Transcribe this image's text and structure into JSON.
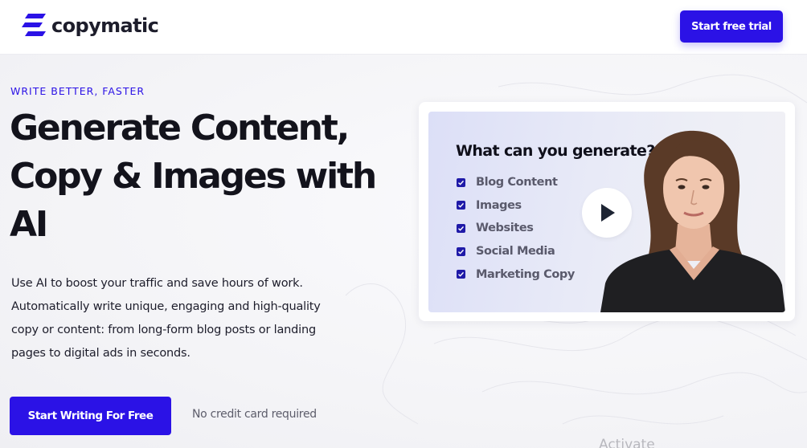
{
  "header": {
    "brand_name": "copymatic",
    "trial_button": "Start free trial"
  },
  "hero": {
    "eyebrow": "WRITE BETTER, FASTER",
    "headline_lines": [
      "Generate Content,",
      "Copy & Images with",
      "AI"
    ],
    "lead_lines": [
      "Use AI to boost your traffic and save hours of work.",
      "Automatically write unique, engaging and high-quality",
      "copy or content: from long-form blog posts or landing",
      "pages to digital ads in seconds."
    ],
    "cta_button": "Start Writing For Free",
    "cta_note": "No credit card required"
  },
  "video": {
    "title": "What can you generate?",
    "items": [
      {
        "label": "Blog Content",
        "icon": "checkbox-checked-icon"
      },
      {
        "label": "Images",
        "icon": "checkbox-checked-icon"
      },
      {
        "label": "Websites",
        "icon": "checkbox-checked-icon"
      },
      {
        "label": "Social Media",
        "icon": "checkbox-checked-icon"
      },
      {
        "label": "Marketing Copy",
        "icon": "checkbox-checked-icon"
      }
    ],
    "play_icon": "play-icon"
  },
  "overlay": {
    "watermark": "Activate"
  },
  "colors": {
    "accent": "#2b12e6",
    "text_dark": "#13131c",
    "checkbox": "#1f1aa8",
    "play_arrow": "#1d2433"
  }
}
